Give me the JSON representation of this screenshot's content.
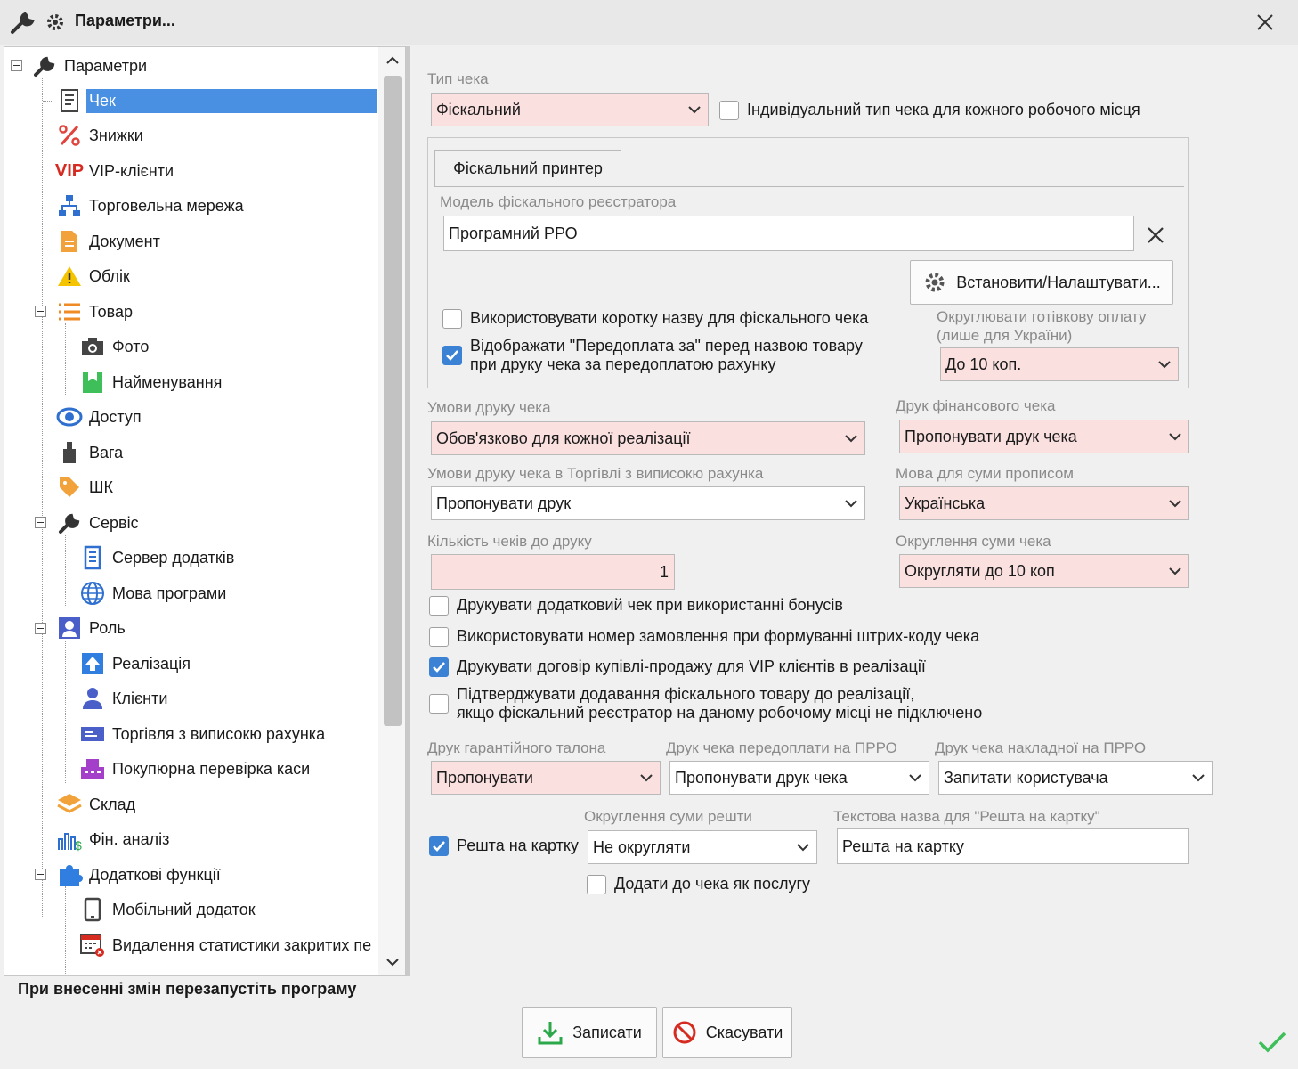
{
  "window": {
    "title": "Параметри..."
  },
  "tree": {
    "items": [
      {
        "label": "Параметри"
      },
      {
        "label": "Чек"
      },
      {
        "label": "Знижки"
      },
      {
        "label": "VIP-клієнти",
        "icon_text": "VIP"
      },
      {
        "label": "Торговельна мережа"
      },
      {
        "label": "Документ"
      },
      {
        "label": "Облік"
      },
      {
        "label": "Товар"
      },
      {
        "label": "Фото"
      },
      {
        "label": "Найменування"
      },
      {
        "label": "Доступ"
      },
      {
        "label": "Вага"
      },
      {
        "label": "ШК"
      },
      {
        "label": "Сервіс"
      },
      {
        "label": "Сервер додатків"
      },
      {
        "label": "Мова програми"
      },
      {
        "label": "Роль"
      },
      {
        "label": "Реалізація"
      },
      {
        "label": "Клієнти"
      },
      {
        "label": "Торгівля з виписокю рахунка"
      },
      {
        "label": "Покупюрна перевірка каси"
      },
      {
        "label": "Склад"
      },
      {
        "label": "Фін. аналіз"
      },
      {
        "label": "Додаткові функції"
      },
      {
        "label": "Мобільний додаток"
      },
      {
        "label": "Видалення статистики закритих пе"
      }
    ],
    "selected_index": 1
  },
  "footer": {
    "restart_message": "При внесенні змін перезапустіть програму",
    "save_label": "Записати",
    "cancel_label": "Скасувати"
  },
  "receipt": {
    "type_label": "Тип чека",
    "type_value": "Фіскальний",
    "individual_type_label": "Індивідуальний тип чека для кожного робочого місця",
    "individual_type_checked": false
  },
  "fiscal": {
    "tab_label": "Фіскальний принтер",
    "model_label": "Модель фіскального реєстратора",
    "model_value": "Програмний РРО",
    "install_label": "Встановити/Налаштувати...",
    "short_name_label": "Використовувати коротку назву для фіскального чека",
    "short_name_checked": false,
    "prepay_label_1": "Відображати \"Передоплата за\" перед назвою товару",
    "prepay_label_2": "при друку чека за передоплатою рахунку",
    "prepay_checked": true,
    "rounding_cash_label_1": "Округлювати готівкову оплату",
    "rounding_cash_label_2": "(лише для України)",
    "rounding_cash_value": "До 10 коп."
  },
  "print_conditions": {
    "label": "Умови друку чека",
    "value": "Обов'язково для кожної реалізації"
  },
  "financial_print": {
    "label": "Друк фінансового чека",
    "value": "Пропонувати друк чека"
  },
  "invoice_print_conditions": {
    "label": "Умови друку чека в Торгівлі з виписокю рахунка",
    "value": "Пропонувати друк"
  },
  "amount_language": {
    "label": "Мова для суми прописом",
    "value": "Українська"
  },
  "copies": {
    "label": "Кількість чеків до друку",
    "value": "1"
  },
  "sum_rounding": {
    "label": "Округлення суми чека",
    "value": "Округляти до 10 коп"
  },
  "options": [
    {
      "label": "Друкувати додатковий чек при використанні бонусів",
      "checked": false
    },
    {
      "label": "Використовувати номер замовлення при формуванні штрих-коду чека",
      "checked": false
    },
    {
      "label": "Друкувати договір купівлі-продажу для VIP клієнтів в реалізації",
      "checked": true
    },
    {
      "label": "Підтверджувати додавання фіскального товару до реалізації,",
      "label2": "якщо фіскальний реєстратор на даному робочому місці не підключено",
      "checked": false
    }
  ],
  "warranty": {
    "label": "Друк гарантійного талона",
    "value": "Пропонувати"
  },
  "prepay_prro": {
    "label": "Друк чека передоплати на ПРРО",
    "value": "Пропонувати друк чека"
  },
  "waybill_prro": {
    "label": "Друк чека накладної на ПРРО",
    "value": "Запитати користувача"
  },
  "change": {
    "to_card_label": "Решта на картку",
    "to_card_checked": true,
    "rounding_label": "Округлення суми решти",
    "rounding_value": "Не округляти",
    "text_label": "Текстова назва для \"Решта на картку\"",
    "text_value": "Решта на картку",
    "as_service_label": "Додати до чека як послугу",
    "as_service_checked": false
  }
}
